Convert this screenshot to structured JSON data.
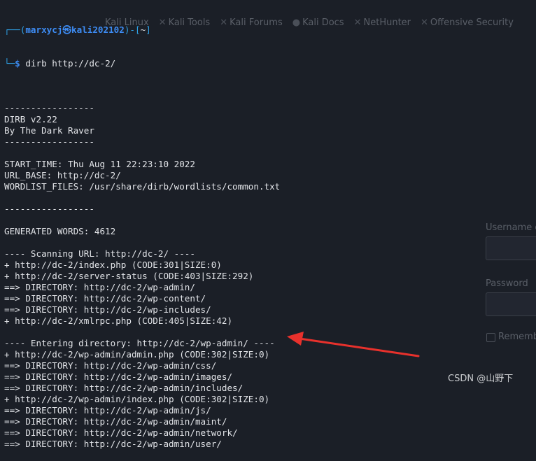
{
  "background": {
    "bookmarks": [
      "Kali Linux",
      "Kali Tools",
      "Kali Forums",
      "Kali Docs",
      "NetHunter",
      "Offensive Security"
    ],
    "form_labels": [
      "Username or",
      "Password"
    ],
    "remember_label": "Remember"
  },
  "prompt": {
    "frame_top": "┌──(",
    "user_host": "marxycj㉿kali202102",
    "frame_mid": ")-[",
    "cwd": "~",
    "frame_end": "]",
    "frame_bottom": "└─",
    "dollar": "$",
    "command": " dirb http://dc-2/"
  },
  "output": [
    "",
    "-----------------",
    "DIRB v2.22",
    "By The Dark Raver",
    "-----------------",
    "",
    "START_TIME: Thu Aug 11 22:23:10 2022",
    "URL_BASE: http://dc-2/",
    "WORDLIST_FILES: /usr/share/dirb/wordlists/common.txt",
    "",
    "-----------------",
    "",
    "GENERATED WORDS: 4612",
    "",
    "---- Scanning URL: http://dc-2/ ----",
    "+ http://dc-2/index.php (CODE:301|SIZE:0)",
    "+ http://dc-2/server-status (CODE:403|SIZE:292)",
    "==> DIRECTORY: http://dc-2/wp-admin/",
    "==> DIRECTORY: http://dc-2/wp-content/",
    "==> DIRECTORY: http://dc-2/wp-includes/",
    "+ http://dc-2/xmlrpc.php (CODE:405|SIZE:42)",
    "",
    "---- Entering directory: http://dc-2/wp-admin/ ----",
    "+ http://dc-2/wp-admin/admin.php (CODE:302|SIZE:0)",
    "==> DIRECTORY: http://dc-2/wp-admin/css/",
    "==> DIRECTORY: http://dc-2/wp-admin/images/",
    "==> DIRECTORY: http://dc-2/wp-admin/includes/",
    "+ http://dc-2/wp-admin/index.php (CODE:302|SIZE:0)",
    "==> DIRECTORY: http://dc-2/wp-admin/js/",
    "==> DIRECTORY: http://dc-2/wp-admin/maint/",
    "==> DIRECTORY: http://dc-2/wp-admin/network/",
    "==> DIRECTORY: http://dc-2/wp-admin/user/"
  ],
  "watermark": "CSDN @山野下",
  "colors": {
    "terminal_bg": "#1b1f27",
    "text": "#e2e4e8",
    "prompt": "#3d8cf4",
    "annotation_arrow": "#e8312c"
  }
}
